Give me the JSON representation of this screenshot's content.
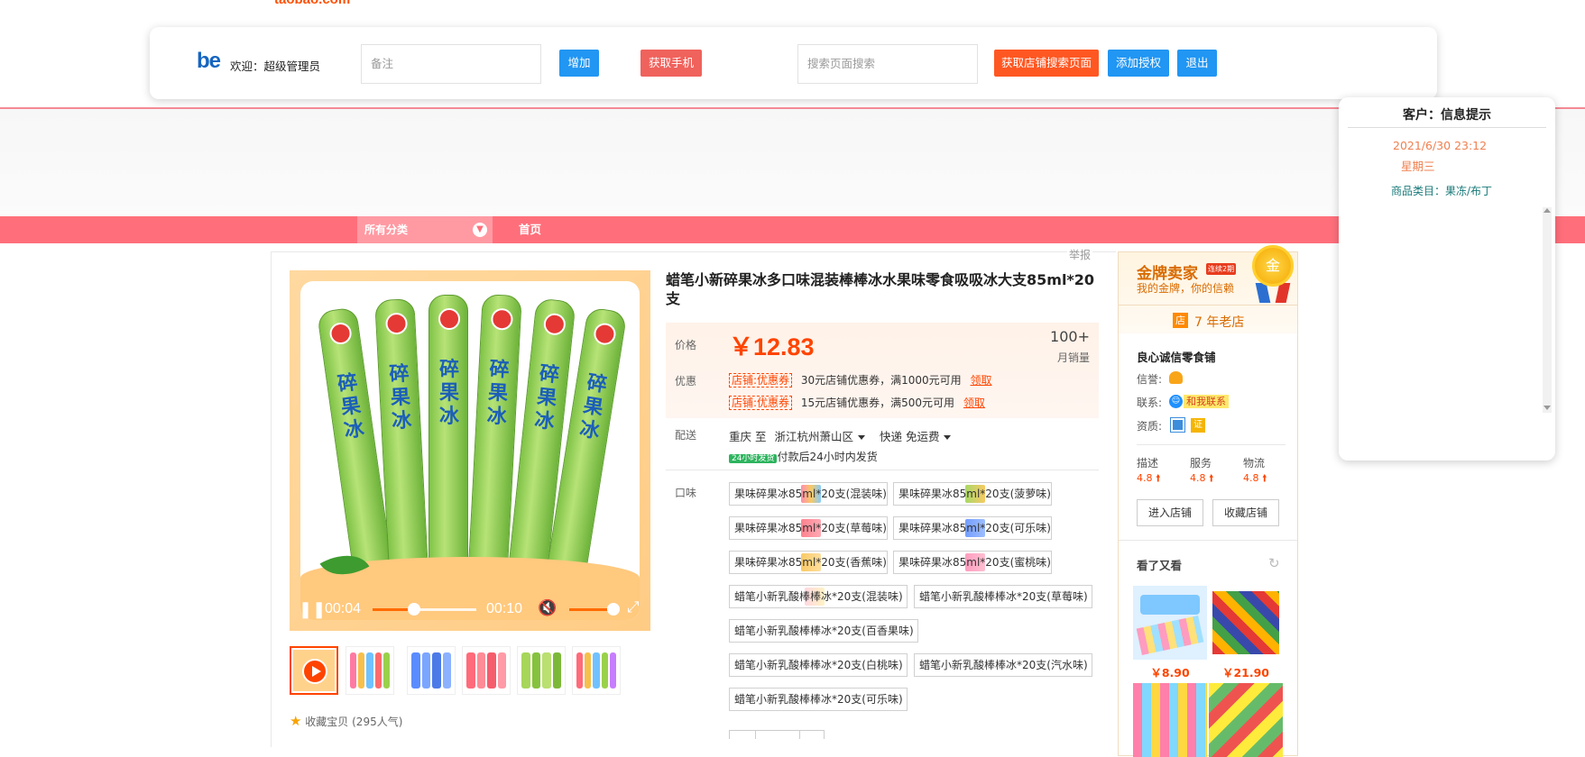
{
  "toolbar": {
    "logo_fragment": "taobao.com",
    "brand_logo": "be",
    "welcome": "欢迎：超级管理员",
    "note_placeholder": "备注",
    "add_label": "增加",
    "get_phone_label": "获取手机",
    "search_placeholder": "搜索页面搜索",
    "get_shop_search_label": "获取店铺搜索页面",
    "add_auth_label": "添加授权",
    "logout_label": "退出"
  },
  "nav": {
    "all_categories": "所有分类",
    "home": "首页"
  },
  "report_label": "举报",
  "video": {
    "current_time": "00:04",
    "duration": "00:10",
    "progress": 0.4,
    "volume": 0.85
  },
  "favorite": {
    "label": "收藏宝贝",
    "count_text": "(295人气)"
  },
  "product": {
    "title": "蜡笔小新碎果冰多口味混装棒棒冰水果味零食吸吸冰大支85ml*20支",
    "image_text": "碎果冰",
    "price_label": "价格",
    "currency": "￥",
    "price": "12.83",
    "sales_count": "100+",
    "sales_label": "月销量",
    "promo_label": "优惠",
    "coupons": [
      {
        "tag": "店铺:优惠券",
        "text": "30元店铺优惠券，满1000元可用",
        "action": "领取"
      },
      {
        "tag": "店铺:优惠券",
        "text": "15元店铺优惠券，满500元可用",
        "action": "领取"
      }
    ],
    "delivery_label": "配送",
    "delivery_to": "重庆 至",
    "delivery_from": "浙江杭州萧山区",
    "shipping": "快递 免运费",
    "badge_24h": "24小时发货",
    "ship_note": "付款后24小时内发货",
    "flavor_label": "口味",
    "flavors": [
      "果味碎果冰85ml*20支(混装味)",
      "果味碎果冰85ml*20支(菠萝味)",
      "果味碎果冰85ml*20支(草莓味)",
      "果味碎果冰85ml*20支(可乐味)",
      "果味碎果冰85ml*20支(香蕉味)",
      "果味碎果冰85ml*20支(蜜桃味)",
      "蜡笔小新乳酸棒棒冰*20支(混装味)",
      "蜡笔小新乳酸棒棒冰*20支(草莓味)",
      "蜡笔小新乳酸棒棒冰*20支(百香果味)",
      "蜡笔小新乳酸棒棒冰*20支(白桃味)",
      "蜡笔小新乳酸棒棒冰*20支(汽水味)",
      "蜡笔小新乳酸棒棒冰*20支(可乐味)"
    ]
  },
  "shop": {
    "gold_title": "金牌卖家",
    "gold_tag": "连续2期",
    "gold_sub": "我的金牌，你的信赖",
    "medal": "金",
    "age_icon": "店",
    "age": "7 年老店",
    "name": "良心诚信零食铺",
    "credit_label": "信誉:",
    "contact_label": "联系:",
    "contact_button": "和我联系",
    "qualification_label": "资质:",
    "qualification_badge": "证",
    "scores": [
      {
        "label": "描述",
        "value": "4.8"
      },
      {
        "label": "服务",
        "value": "4.8"
      },
      {
        "label": "物流",
        "value": "4.8"
      }
    ],
    "enter_shop": "进入店铺",
    "favorite_shop": "收藏店铺",
    "also_viewed": "看了又看",
    "recommend": [
      {
        "price": "￥8.90"
      },
      {
        "price": "￥21.90"
      }
    ]
  },
  "popup": {
    "title": "客户：信息提示",
    "date": "2021/6/30 23:12",
    "weekday": "星期三",
    "category": "商品类目：果冻/布丁"
  },
  "colors": {
    "nav_pink": "#ff6f7b",
    "accent_orange": "#ff4400",
    "button_blue": "#2196f3"
  }
}
